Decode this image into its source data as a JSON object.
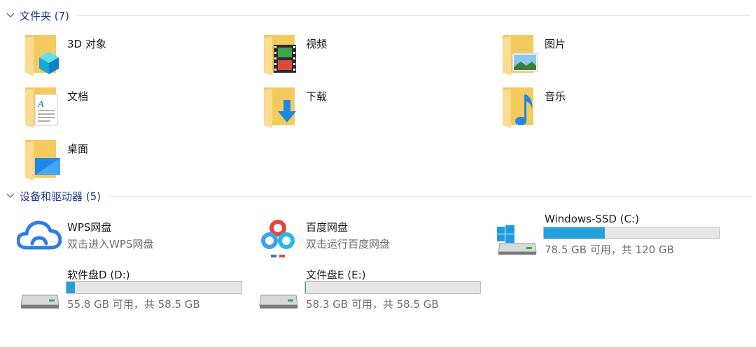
{
  "folders_section": {
    "title": "文件夹 (7)"
  },
  "folders": [
    {
      "name": "3D 对象",
      "icon": "3d-objects-folder-icon"
    },
    {
      "name": "视频",
      "icon": "videos-folder-icon"
    },
    {
      "name": "图片",
      "icon": "pictures-folder-icon"
    },
    {
      "name": "文档",
      "icon": "documents-folder-icon"
    },
    {
      "name": "下载",
      "icon": "downloads-folder-icon"
    },
    {
      "name": "音乐",
      "icon": "music-folder-icon"
    },
    {
      "name": "桌面",
      "icon": "desktop-folder-icon"
    }
  ],
  "devices_section": {
    "title": "设备和驱动器 (5)"
  },
  "apps": [
    {
      "name": "WPS网盘",
      "sub": "双击进入WPS网盘",
      "icon": "wps-cloud-icon"
    },
    {
      "name": "百度网盘",
      "sub": "双击运行百度网盘",
      "icon": "baidu-netdisk-icon"
    }
  ],
  "drives": [
    {
      "name": "Windows-SSD (C:)",
      "sub": "78.5 GB 可用，共 120 GB",
      "used_fraction": 0.346,
      "icon": "windows-drive-icon"
    },
    {
      "name": "软件盘D (D:)",
      "sub": "55.8 GB 可用，共 58.5 GB",
      "used_fraction": 0.046,
      "icon": "hard-drive-icon"
    },
    {
      "name": "文件盘E (E:)",
      "sub": "58.3 GB 可用，共 58.5 GB",
      "used_fraction": 0.003,
      "icon": "hard-drive-icon"
    }
  ],
  "colors": {
    "section_title": "#1e3287",
    "bar_fill": "#26a0da",
    "folder": "#f4c95d"
  }
}
